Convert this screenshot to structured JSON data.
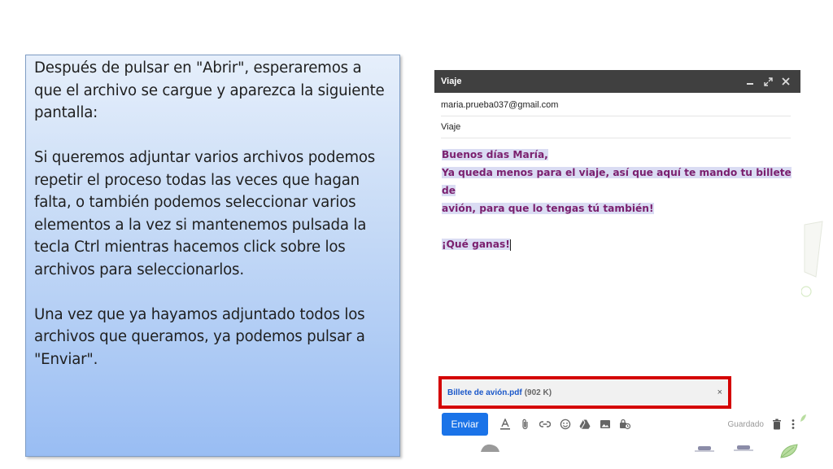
{
  "instructions": {
    "p1": "Después de pulsar en \"Abrir\", esperaremos a que el archivo se cargue y aparezca la siguiente pantalla:",
    "p2": "Si queremos adjuntar varios archivos podemos repetir el proceso todas las veces que hagan falta, o también podemos seleccionar varios elementos a la vez si mantenemos pulsada la tecla Ctrl mientras hacemos click sobre los archivos para seleccionarlos.",
    "p3": "Una vez que ya hayamos adjuntado todos los archivos que queramos, ya podemos pulsar a \"Enviar\"."
  },
  "compose": {
    "title": "Viaje",
    "to": "maria.prueba037@gmail.com",
    "subject": "Viaje",
    "body": {
      "line1": "Buenos días María,",
      "line2": "Ya queda menos para el viaje, así que aquí te mando tu billete de",
      "line3": "avión, para que lo tengas tú también!",
      "line4": "¡Qué ganas!"
    },
    "attachment": {
      "name": "Billete de avión.pdf",
      "size": "(902 K)",
      "close": "×"
    },
    "send_label": "Enviar",
    "saved_label": "Guardado",
    "header_icons": [
      "minimize-icon",
      "expand-icon",
      "close-icon"
    ],
    "toolbar_icons": [
      "format-text-icon",
      "attach-icon",
      "link-icon",
      "emoji-icon",
      "drive-icon",
      "image-icon",
      "confidential-icon"
    ]
  },
  "colors": {
    "send": "#1a73e8",
    "header": "#404040",
    "attachment_border": "#d40000",
    "body_text": "#7a1f6e",
    "highlight": "#dadcf3",
    "attachment_link": "#1a57c9"
  }
}
